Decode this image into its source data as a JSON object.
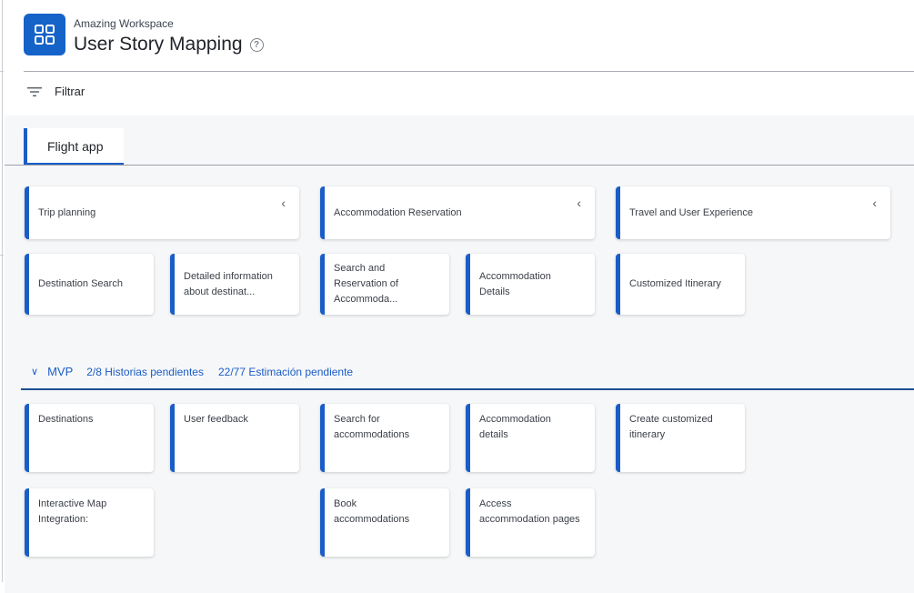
{
  "header": {
    "workspace": "Amazing Workspace",
    "title": "User Story Mapping",
    "help": "?",
    "logo_icon": "grid-icon"
  },
  "toolbar": {
    "filter_label": "Filtrar",
    "filter_icon": "filter-icon"
  },
  "tabs": [
    {
      "label": "Flight app"
    }
  ],
  "activities": [
    {
      "label": "Trip planning"
    },
    {
      "label": "Accommodation Reservation"
    },
    {
      "label": "Travel and User Experience"
    }
  ],
  "steps": [
    {
      "lines": [
        "Destination Search"
      ]
    },
    {
      "lines": [
        "Detailed information",
        "about destinat..."
      ]
    },
    {
      "lines": [
        "Search and",
        "Reservation of",
        "Accommoda..."
      ]
    },
    {
      "lines": [
        "Accommodation",
        "Details"
      ]
    },
    {
      "lines": [
        "Customized Itinerary"
      ]
    }
  ],
  "release": {
    "name": "MVP",
    "pending_stories": "2/8 Historias pendientes",
    "pending_estimation": "22/77 Estimación pendiente"
  },
  "stories": [
    {
      "lines": [
        "Destinations"
      ]
    },
    {
      "lines": [
        "User feedback"
      ]
    },
    {
      "lines": [
        "Search for",
        "accommodations"
      ]
    },
    {
      "lines": [
        "Accommodation",
        "details"
      ]
    },
    {
      "lines": [
        "Create customized",
        "itinerary"
      ]
    },
    {
      "lines": [
        "Interactive Map",
        "Integration:"
      ]
    },
    {
      "lines": [
        "Book",
        "accommodations"
      ]
    },
    {
      "lines": [
        "Access",
        "accommodation pages"
      ]
    }
  ],
  "colors": {
    "accent": "#1a5dc7",
    "logo": "#1563c8",
    "board_bg": "#f6f7f9"
  }
}
